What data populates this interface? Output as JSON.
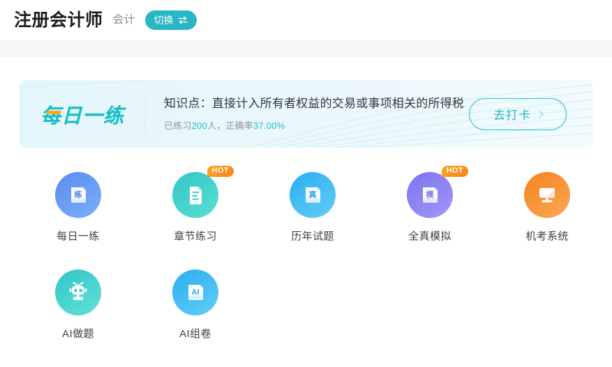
{
  "header": {
    "title": "注册会计师",
    "subject": "会计",
    "switch_label": "切换",
    "switch_icon": "swap-arrows-icon"
  },
  "banner": {
    "logo_text": "每日一练",
    "knowledge_point": "知识点：直接计入所有者权益的交易或事项相关的所得税",
    "stats": {
      "prefix": "已练习",
      "count": "200",
      "middle": "人，正确率",
      "accuracy": "37.00%"
    },
    "cta_label": "去打卡",
    "cta_icon": "chevron-right-icon"
  },
  "grid": {
    "rows": [
      [
        {
          "label": "每日一练",
          "icon": "scroll-lian-icon",
          "badge": "",
          "color_from": "#5b8df0",
          "color_to": "#6fa3f7"
        },
        {
          "label": "章节练习",
          "icon": "document-lines-icon",
          "badge": "HOT",
          "color_from": "#34c5c8",
          "color_to": "#4fdcd2"
        },
        {
          "label": "历年试题",
          "icon": "scroll-zhen-icon",
          "badge": "",
          "color_from": "#29aef0",
          "color_to": "#5ec8f7"
        },
        {
          "label": "全真模拟",
          "icon": "scroll-mo-icon",
          "badge": "HOT",
          "color_from": "#7b74ef",
          "color_to": "#9a8ef7"
        },
        {
          "label": "机考系统",
          "icon": "monitor-icon",
          "badge": "",
          "color_from": "#f58220",
          "color_to": "#fba14f"
        }
      ],
      [
        {
          "label": "AI做题",
          "icon": "robot-icon",
          "badge": "",
          "color_from": "#2fc5c8",
          "color_to": "#5ee0d4"
        },
        {
          "label": "AI组卷",
          "icon": "scroll-ai-icon",
          "badge": "",
          "color_from": "#29aef0",
          "color_to": "#5ec8f7"
        }
      ]
    ]
  },
  "colors": {
    "accent_teal": "#29b6c6",
    "accent_orange": "#f5a623",
    "band_grey": "#f5f6f8"
  }
}
